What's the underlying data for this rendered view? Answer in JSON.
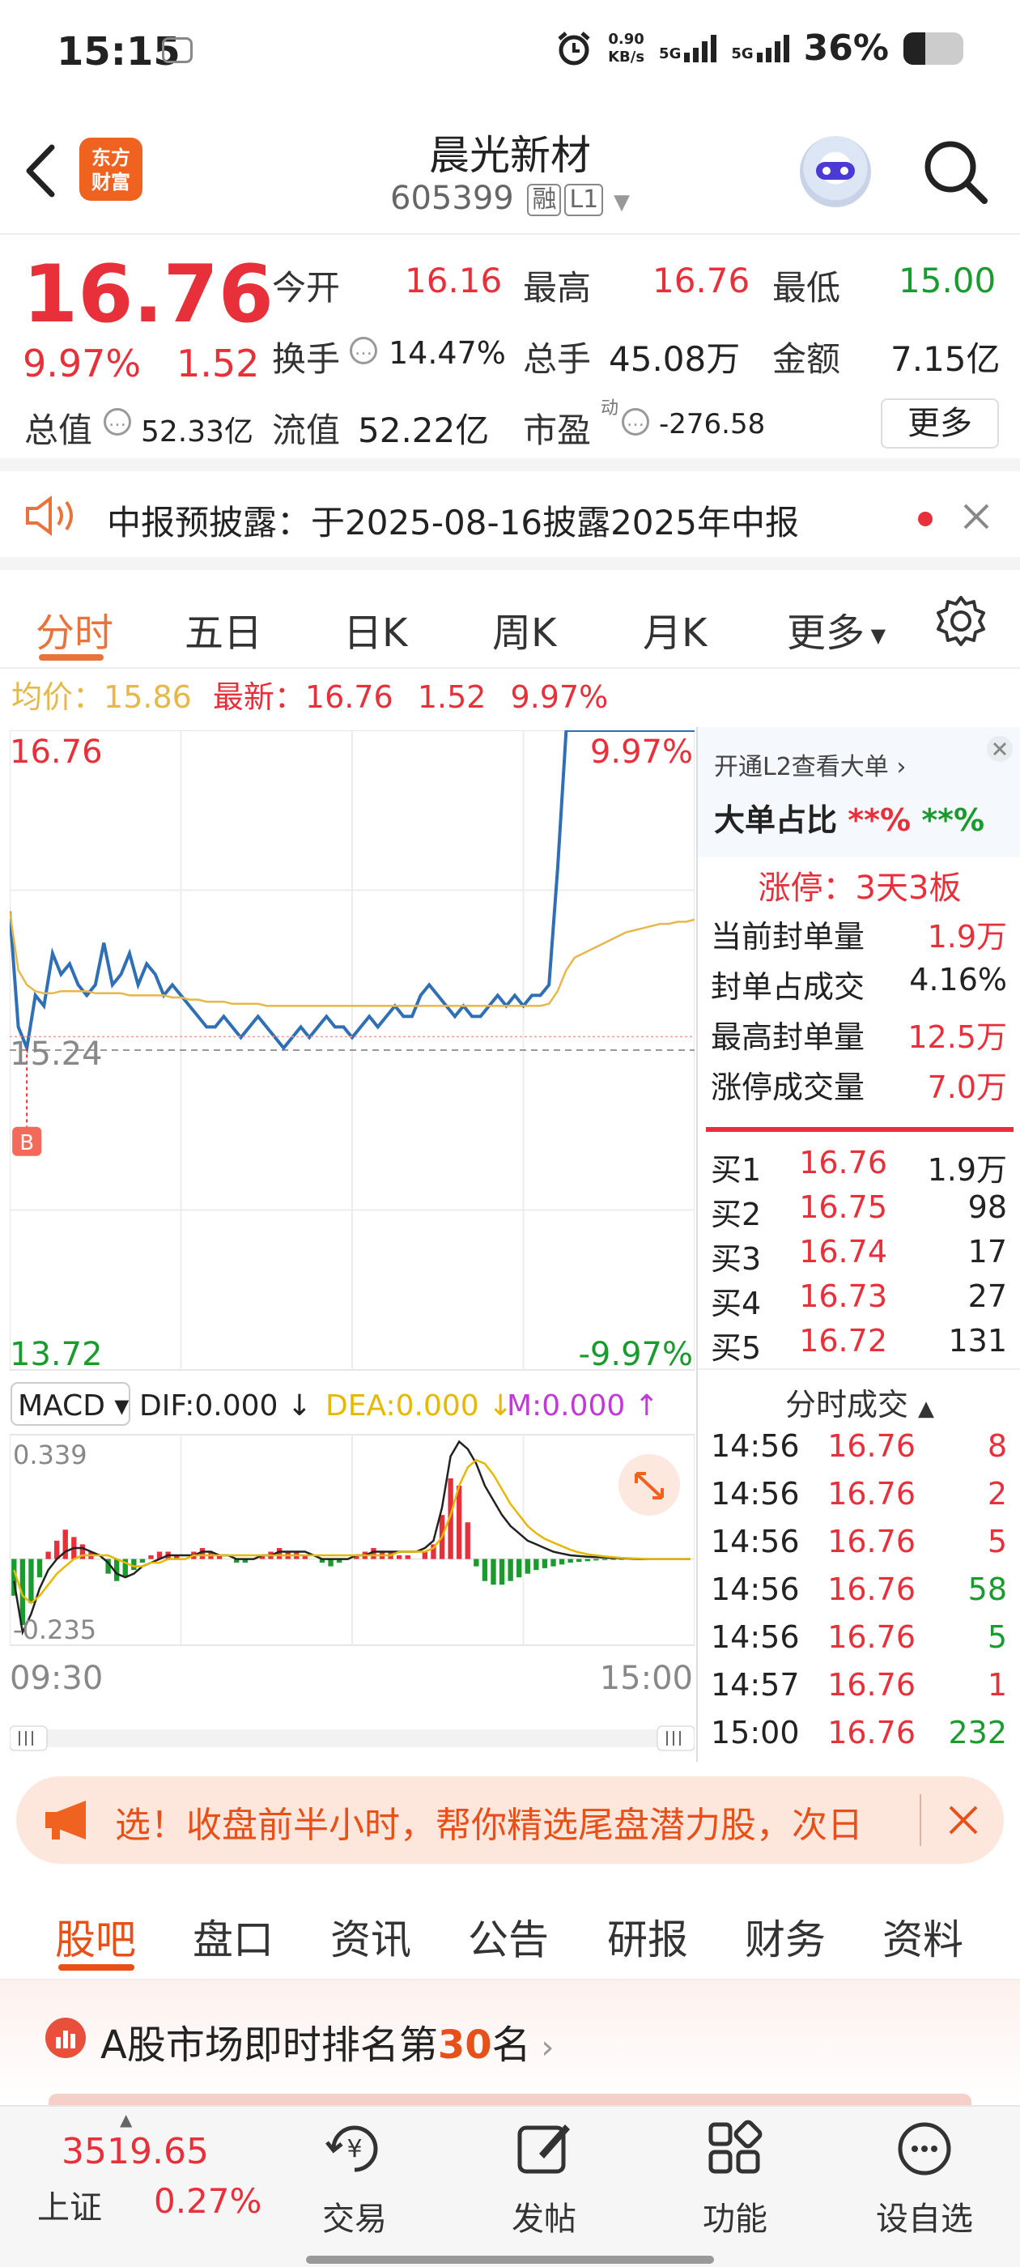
{
  "status_bar": {
    "time": "15:15",
    "net_speed_value": "0.90",
    "net_speed_unit": "KB/s",
    "sim1": "5G",
    "sim2": "5G",
    "battery": "36%",
    "battery_level": 0.36
  },
  "header": {
    "logo_line1": "东方",
    "logo_line2": "财富",
    "stock_name": "晨光新材",
    "stock_code": "605399",
    "tag_margin": "融",
    "tag_level": "L1"
  },
  "quote": {
    "price": "16.76",
    "change_pct": "9.97%",
    "change": "1.52",
    "open_label": "今开",
    "open": "16.16",
    "high_label": "最高",
    "high": "16.76",
    "low_label": "最低",
    "low": "15.00",
    "turnover_label": "换手",
    "turnover": "14.47%",
    "volume_label": "总手",
    "volume": "45.08万",
    "amount_label": "金额",
    "amount": "7.15亿",
    "mcap_label": "总值",
    "mcap": "52.33亿",
    "float_label": "流值",
    "float_cap": "52.22亿",
    "pe_label": "市盈",
    "pe_sup": "动",
    "pe": "-276.58",
    "more_button": "更多"
  },
  "notice": {
    "text": "中报预披露：于2025-08-16披露2025年中报"
  },
  "chart_tabs": [
    "分时",
    "五日",
    "日K",
    "周K",
    "月K",
    "更多"
  ],
  "summary": {
    "avg_label": "均价：",
    "avg": "15.86",
    "latest_label": "最新：",
    "latest": "16.76",
    "change": "1.52",
    "pct": "9.97%"
  },
  "chart_labels": {
    "top_price": "16.76",
    "top_pct": "9.97%",
    "mid_price": "15.24",
    "bottom_price": "13.72",
    "bottom_pct": "-9.97%",
    "marker": "B",
    "time_start": "09:30",
    "time_end": "15:00"
  },
  "macd": {
    "name": "MACD",
    "dif": "DIF:0.000",
    "dea": "DEA:0.000",
    "m": "M:0.000",
    "top": "0.339",
    "bottom": "-0.235"
  },
  "chart_data": [
    {
      "type": "line",
      "x_range": [
        "09:30",
        "15:00"
      ],
      "ylim": [
        13.72,
        16.76
      ],
      "prev_close": 15.24,
      "series": [
        {
          "values": [
            15.9,
            15.35,
            15.25,
            15.5,
            15.45,
            15.7,
            15.6,
            15.65,
            15.55,
            15.5,
            15.55,
            15.75,
            15.55,
            15.6,
            15.7,
            15.55,
            15.65,
            15.6,
            15.5,
            15.55,
            15.5,
            15.45,
            15.4,
            15.35,
            15.35,
            15.4,
            15.35,
            15.3,
            15.35,
            15.4,
            15.35,
            15.3,
            15.25,
            15.3,
            15.35,
            15.3,
            15.35,
            15.4,
            15.35,
            15.35,
            15.3,
            15.35,
            15.4,
            15.35,
            15.4,
            15.45,
            15.4,
            15.4,
            15.5,
            15.55,
            15.5,
            15.45,
            15.4,
            15.45,
            15.4,
            15.4,
            15.45,
            15.5,
            15.45,
            15.5,
            15.45,
            15.5,
            15.5,
            15.55,
            16.1,
            16.76,
            16.76,
            16.76,
            16.76,
            16.76,
            16.76,
            16.76,
            16.76,
            16.76,
            16.76,
            16.76,
            16.76,
            16.76,
            16.76,
            16.76,
            16.76
          ]
        },
        {
          "values": [
            15.9,
            15.62,
            15.55,
            15.52,
            15.51,
            15.51,
            15.52,
            15.52,
            15.52,
            15.52,
            15.51,
            15.51,
            15.51,
            15.51,
            15.5,
            15.5,
            15.5,
            15.5,
            15.5,
            15.49,
            15.49,
            15.48,
            15.48,
            15.47,
            15.47,
            15.47,
            15.46,
            15.46,
            15.46,
            15.46,
            15.45,
            15.45,
            15.45,
            15.45,
            15.45,
            15.45,
            15.45,
            15.45,
            15.45,
            15.45,
            15.45,
            15.45,
            15.45,
            15.45,
            15.45,
            15.45,
            15.45,
            15.45,
            15.45,
            15.45,
            15.45,
            15.45,
            15.45,
            15.45,
            15.45,
            15.45,
            15.45,
            15.45,
            15.45,
            15.45,
            15.45,
            15.45,
            15.45,
            15.46,
            15.52,
            15.62,
            15.68,
            15.7,
            15.72,
            15.74,
            15.76,
            15.78,
            15.8,
            15.81,
            15.82,
            15.83,
            15.84,
            15.84,
            15.85,
            15.85,
            15.86
          ]
        }
      ]
    },
    {
      "type": "bar",
      "ylim": [
        -0.235,
        0.339
      ],
      "series": [
        {
          "name": "M",
          "values": [
            -0.1,
            -0.18,
            -0.12,
            -0.05,
            0.02,
            0.05,
            0.08,
            0.06,
            0.04,
            0.02,
            0.0,
            -0.04,
            -0.06,
            -0.05,
            -0.03,
            -0.01,
            0.01,
            0.02,
            0.02,
            0.01,
            0.0,
            0.02,
            0.03,
            0.02,
            0.01,
            0.0,
            -0.01,
            -0.01,
            0.0,
            0.01,
            0.02,
            0.03,
            0.02,
            0.02,
            0.01,
            0.0,
            -0.01,
            -0.02,
            -0.01,
            0.0,
            0.01,
            0.02,
            0.03,
            0.02,
            0.02,
            0.01,
            0.01,
            0.0,
            0.02,
            0.04,
            0.12,
            0.22,
            0.2,
            0.1,
            -0.02,
            -0.06,
            -0.07,
            -0.07,
            -0.06,
            -0.05,
            -0.04,
            -0.03,
            -0.025,
            -0.02,
            -0.015,
            -0.01,
            -0.008,
            -0.006,
            -0.004,
            -0.003,
            -0.002,
            -0.001,
            0.0,
            0.0,
            0.0,
            0.0,
            0.0,
            0.0,
            0.0,
            0.0
          ]
        },
        {
          "name": "DIF",
          "values": [
            -0.06,
            -0.2,
            -0.15,
            -0.08,
            -0.03,
            0.0,
            0.02,
            0.03,
            0.03,
            0.02,
            0.01,
            -0.01,
            -0.04,
            -0.05,
            -0.04,
            -0.02,
            -0.01,
            0.0,
            0.01,
            0.01,
            0.01,
            0.01,
            0.02,
            0.02,
            0.01,
            0.01,
            0.0,
            0.0,
            0.0,
            0.01,
            0.01,
            0.02,
            0.02,
            0.02,
            0.02,
            0.01,
            0.0,
            0.0,
            0.0,
            0.0,
            0.01,
            0.01,
            0.02,
            0.02,
            0.02,
            0.02,
            0.02,
            0.02,
            0.03,
            0.05,
            0.14,
            0.28,
            0.32,
            0.3,
            0.26,
            0.2,
            0.16,
            0.12,
            0.09,
            0.07,
            0.05,
            0.04,
            0.03,
            0.02,
            0.015,
            0.01,
            0.008,
            0.006,
            0.005,
            0.004,
            0.003,
            0.002,
            0.001,
            0.0,
            0.0,
            0.0,
            0.0,
            0.0,
            0.0,
            0.0
          ]
        },
        {
          "name": "DEA",
          "values": [
            -0.03,
            -0.1,
            -0.12,
            -0.1,
            -0.07,
            -0.04,
            -0.02,
            0.0,
            0.01,
            0.01,
            0.01,
            0.01,
            0.0,
            -0.01,
            -0.02,
            -0.02,
            -0.01,
            -0.01,
            0.0,
            0.0,
            0.0,
            0.01,
            0.01,
            0.01,
            0.01,
            0.01,
            0.01,
            0.01,
            0.01,
            0.01,
            0.01,
            0.01,
            0.01,
            0.01,
            0.01,
            0.01,
            0.01,
            0.01,
            0.01,
            0.01,
            0.01,
            0.01,
            0.01,
            0.01,
            0.01,
            0.02,
            0.02,
            0.02,
            0.02,
            0.03,
            0.06,
            0.12,
            0.2,
            0.25,
            0.27,
            0.26,
            0.23,
            0.19,
            0.15,
            0.12,
            0.09,
            0.07,
            0.055,
            0.045,
            0.035,
            0.025,
            0.018,
            0.013,
            0.01,
            0.007,
            0.005,
            0.003,
            0.002,
            0.001,
            0.0,
            0.0,
            0.0,
            0.0,
            0.0,
            0.0
          ]
        }
      ]
    }
  ],
  "side_panel": {
    "l2_link": "开通L2查看大单",
    "big_order_label": "大单占比",
    "big_buy": "**%",
    "big_sell": "**%",
    "limit_up": "涨停：3天3板",
    "stats": [
      {
        "label": "当前封单量",
        "value": "1.9万"
      },
      {
        "label": "封单占成交",
        "value": "4.16%"
      },
      {
        "label": "最高封单量",
        "value": "12.5万"
      },
      {
        "label": "涨停成交量",
        "value": "7.0万"
      }
    ],
    "bids": [
      {
        "label": "买1",
        "price": "16.76",
        "vol": "1.9万"
      },
      {
        "label": "买2",
        "price": "16.75",
        "vol": "98"
      },
      {
        "label": "买3",
        "price": "16.74",
        "vol": "17"
      },
      {
        "label": "买4",
        "price": "16.73",
        "vol": "27"
      },
      {
        "label": "买5",
        "price": "16.72",
        "vol": "131"
      }
    ],
    "ticks_title": "分时成交",
    "ticks": [
      {
        "time": "14:56",
        "price": "16.76",
        "vol": "8",
        "color": "red"
      },
      {
        "time": "14:56",
        "price": "16.76",
        "vol": "2",
        "color": "red"
      },
      {
        "time": "14:56",
        "price": "16.76",
        "vol": "5",
        "color": "red"
      },
      {
        "time": "14:56",
        "price": "16.76",
        "vol": "58",
        "color": "green"
      },
      {
        "time": "14:56",
        "price": "16.76",
        "vol": "5",
        "color": "green"
      },
      {
        "time": "14:57",
        "price": "16.76",
        "vol": "1",
        "color": "red"
      },
      {
        "time": "15:00",
        "price": "16.76",
        "vol": "232",
        "color": "green"
      }
    ]
  },
  "promo": {
    "text": "选！收盘前半小时，帮你精选尾盘潜力股，次日"
  },
  "bottom_tabs": [
    "股吧",
    "盘口",
    "资讯",
    "公告",
    "研报",
    "财务",
    "资料"
  ],
  "rank": {
    "prefix": "A股市场即时排名第",
    "num": "30",
    "suffix": "名"
  },
  "nav": {
    "index_value": "3519.65",
    "index_name": "上证",
    "index_pct": "0.27%",
    "trade": "交易",
    "post": "发帖",
    "func": "功能",
    "watch": "设自选"
  },
  "colors": {
    "up": "#e8303b",
    "down": "#1a9b2e",
    "price_line": "#2e6fb5",
    "avg_line": "#e6b84a",
    "accent": "#f0621f"
  }
}
